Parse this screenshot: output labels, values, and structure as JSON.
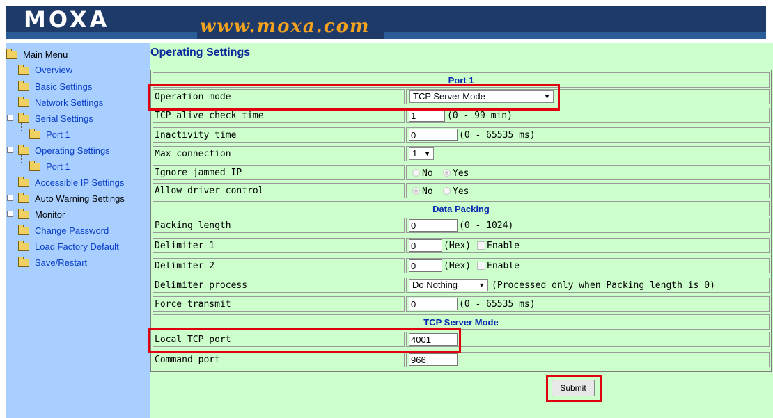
{
  "brand": {
    "logo": "MOXA",
    "url": "www.moxa.com"
  },
  "sidebar": {
    "root": "Main Menu",
    "items": [
      {
        "label": "Overview"
      },
      {
        "label": "Basic Settings"
      },
      {
        "label": "Network Settings"
      },
      {
        "label": "Serial Settings"
      },
      {
        "label": "Port 1"
      },
      {
        "label": "Operating Settings"
      },
      {
        "label": "Port 1"
      },
      {
        "label": "Accessible IP Settings"
      },
      {
        "label": "Auto Warning Settings"
      },
      {
        "label": "Monitor"
      },
      {
        "label": "Change Password"
      },
      {
        "label": "Load Factory Default"
      },
      {
        "label": "Save/Restart"
      }
    ]
  },
  "page": {
    "title": "Operating Settings"
  },
  "form": {
    "section_port": "Port 1",
    "operation_mode": {
      "label": "Operation mode",
      "value": "TCP Server Mode"
    },
    "tcp_alive": {
      "label": "TCP alive check time",
      "value": "1",
      "note": "(0 - 99 min)"
    },
    "inactivity": {
      "label": "Inactivity time",
      "value": "0",
      "note": "(0 - 65535 ms)"
    },
    "max_conn": {
      "label": "Max connection",
      "value": "1"
    },
    "ignore_jammed": {
      "label": "Ignore jammed IP",
      "no": "No",
      "yes": "Yes",
      "selected": "Yes"
    },
    "driver_control": {
      "label": "Allow driver control",
      "no": "No",
      "yes": "Yes",
      "selected": "No"
    },
    "section_packing": "Data Packing",
    "packing_length": {
      "label": "Packing length",
      "value": "0",
      "note": "(0 - 1024)"
    },
    "delim1": {
      "label": "Delimiter 1",
      "value": "0",
      "hex": "(Hex)",
      "enable": "Enable"
    },
    "delim2": {
      "label": "Delimiter 2",
      "value": "0",
      "hex": "(Hex)",
      "enable": "Enable"
    },
    "delim_process": {
      "label": "Delimiter process",
      "value": "Do Nothing",
      "note": "(Processed only when Packing length is 0)"
    },
    "force_tx": {
      "label": "Force transmit",
      "value": "0",
      "note": "(0 - 65535 ms)"
    },
    "section_server": "TCP Server Mode",
    "local_port": {
      "label": "Local TCP port",
      "value": "4001"
    },
    "command_port": {
      "label": "Command port",
      "value": "966"
    },
    "submit": "Submit"
  }
}
